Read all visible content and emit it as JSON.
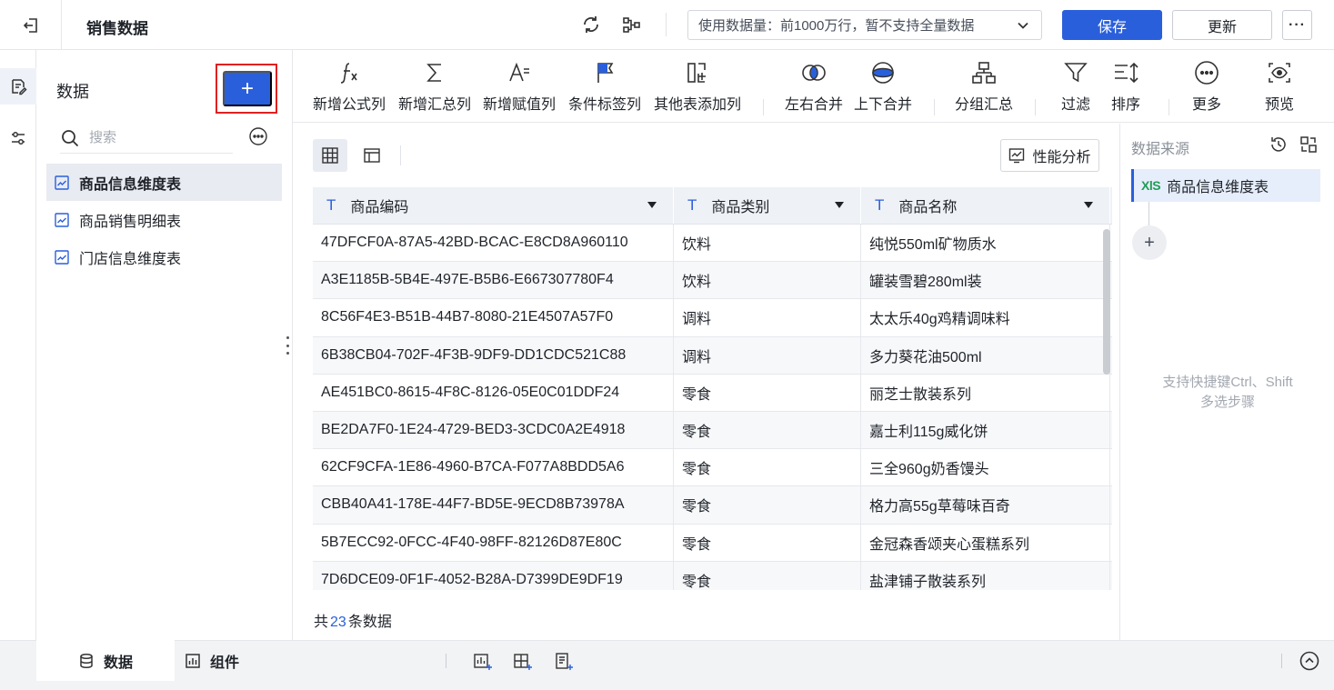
{
  "header": {
    "title": "销售数据",
    "data_usage": "使用数据量：前1000万行，暂不支持全量数据",
    "save_label": "保存",
    "update_label": "更新",
    "more_label": "···"
  },
  "data_panel": {
    "title": "数据",
    "add_label": "+",
    "search_placeholder": "搜索",
    "tables": [
      {
        "label": "商品信息维度表",
        "active": true
      },
      {
        "label": "商品销售明细表",
        "active": false
      },
      {
        "label": "门店信息维度表",
        "active": false
      }
    ]
  },
  "toolbar": {
    "items": [
      {
        "label": "新增公式列",
        "icon": "formula-icon"
      },
      {
        "label": "新增汇总列",
        "icon": "sigma-icon"
      },
      {
        "label": "新增赋值列",
        "icon": "assign-icon"
      },
      {
        "label": "条件标签列",
        "icon": "flag-icon"
      },
      {
        "label": "其他表添加列",
        "icon": "add-column-icon"
      },
      {
        "label": "左右合并",
        "icon": "merge-horizontal-icon"
      },
      {
        "label": "上下合并",
        "icon": "merge-vertical-icon"
      },
      {
        "label": "分组汇总",
        "icon": "group-icon"
      },
      {
        "label": "过滤",
        "icon": "filter-icon"
      },
      {
        "label": "排序",
        "icon": "sort-icon"
      },
      {
        "label": "更多",
        "icon": "more-icon"
      },
      {
        "label": "预览",
        "icon": "preview-icon"
      }
    ]
  },
  "main": {
    "perf_label": "性能分析",
    "columns": [
      {
        "type_icon": "T",
        "label": "商品编码"
      },
      {
        "type_icon": "T",
        "label": "商品类别"
      },
      {
        "type_icon": "T",
        "label": "商品名称"
      }
    ],
    "rows": [
      [
        "47DFCF0A-87A5-42BD-BCAC-E8CD8A960110",
        "饮料",
        "纯悦550ml矿物质水"
      ],
      [
        "A3E1185B-5B4E-497E-B5B6-E667307780F4",
        "饮料",
        "罐装雪碧280ml装"
      ],
      [
        "8C56F4E3-B51B-44B7-8080-21E4507A57F0",
        "调料",
        "太太乐40g鸡精调味料"
      ],
      [
        "6B38CB04-702F-4F3B-9DF9-DD1CDC521C88",
        "调料",
        "多力葵花油500ml"
      ],
      [
        "AE451BC0-8615-4F8C-8126-05E0C01DDF24",
        "零食",
        "丽芝士散装系列"
      ],
      [
        "BE2DA7F0-1E24-4729-BED3-3CDC0A2E4918",
        "零食",
        "嘉士利115g威化饼"
      ],
      [
        "62CF9CFA-1E86-4960-B7CA-F077A8BDD5A6",
        "零食",
        "三全960g奶香馒头"
      ],
      [
        "CBB40A41-178E-44F7-BD5E-9ECD8B73978A",
        "零食",
        "格力高55g草莓味百奇"
      ],
      [
        "5B7ECC92-0FCC-4F40-98FF-82126D87E80C",
        "零食",
        "金冠森香颂夹心蛋糕系列"
      ],
      [
        "7D6DCE09-0F1F-4052-B28A-D7399DE9DF19",
        "零食",
        "盐津铺子散装系列"
      ]
    ],
    "count_prefix": "共",
    "count": "23",
    "count_suffix": "条数据"
  },
  "right_panel": {
    "title": "数据来源",
    "source_badge": "XlS",
    "source_label": "商品信息维度表",
    "add_label": "+",
    "hint_line1": "支持快捷键Ctrl、Shift",
    "hint_line2": "多选步骤"
  },
  "bottom": {
    "tab_data": "数据",
    "tab_component": "组件"
  },
  "colors": {
    "primary": "#2a5fdb",
    "highlight_border": "#e02020",
    "xls_green": "#1f9d55"
  }
}
